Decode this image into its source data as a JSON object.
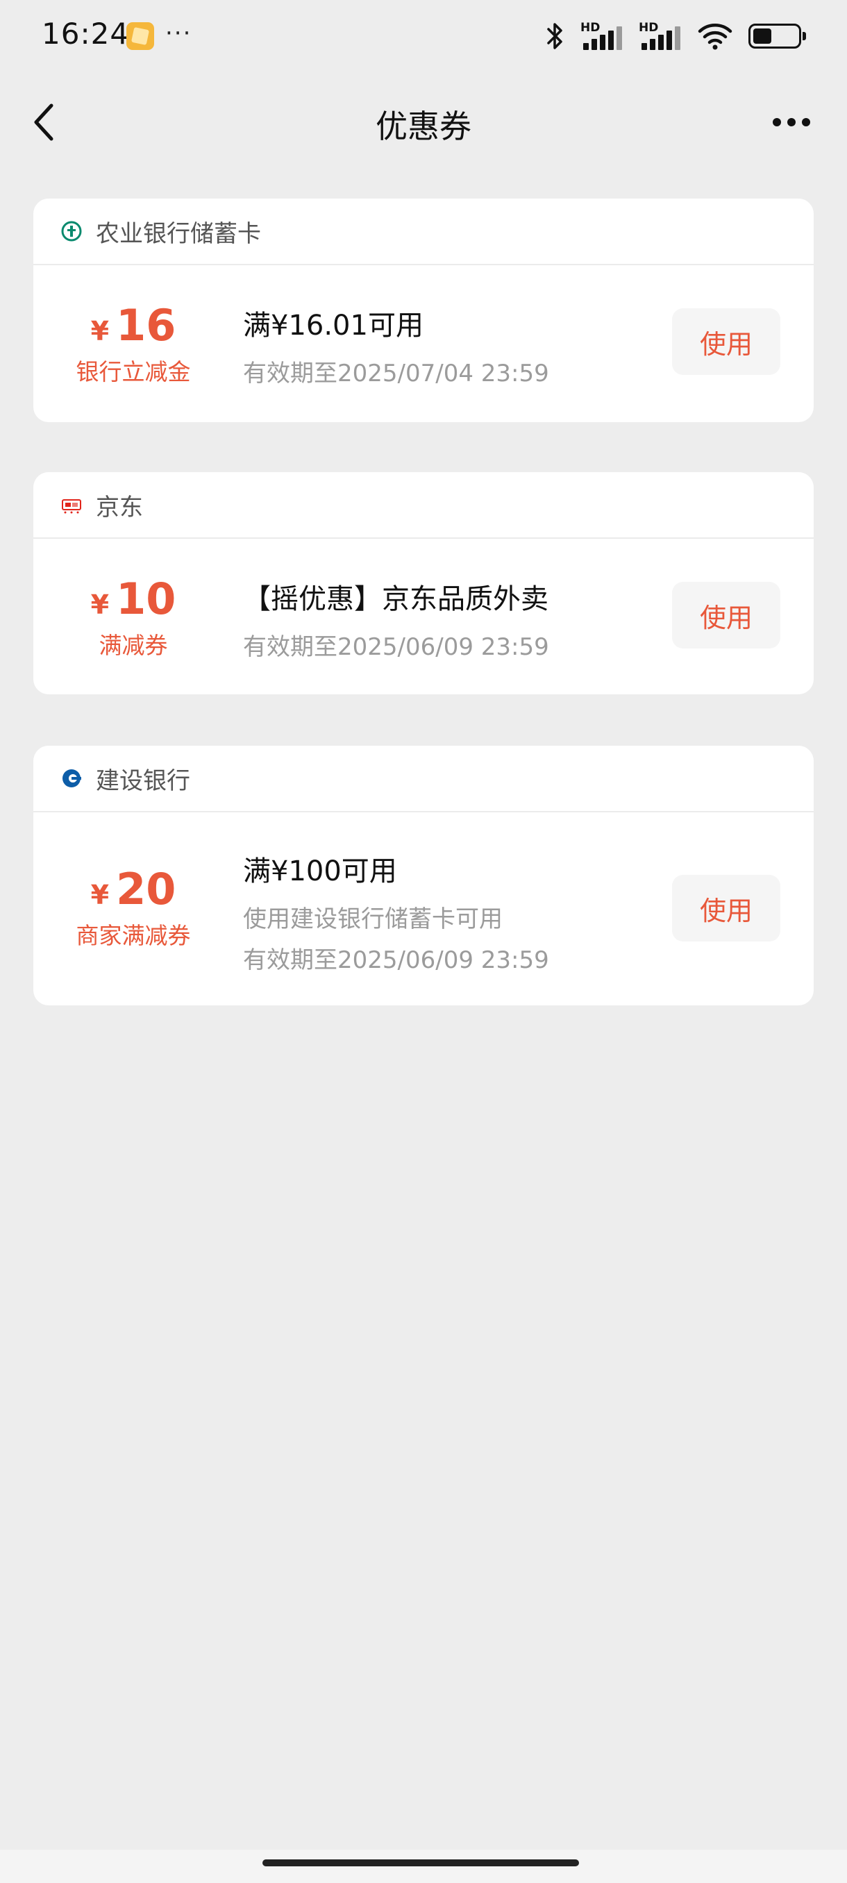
{
  "status_bar": {
    "time": "16:24",
    "more": "···",
    "signal1_label": "HD",
    "signal2_label": "HD",
    "battery_level": 0.42,
    "icons": [
      "notification-app-icon",
      "bluetooth-icon",
      "signal-icon",
      "signal-icon",
      "wifi-icon",
      "battery-icon"
    ]
  },
  "nav": {
    "title": "优惠券",
    "back_icon": "chevron-left-icon",
    "more_icon": "more-dots-icon"
  },
  "accent_color": "#e8583a",
  "coupons": [
    {
      "merchant": "农业银行储蓄卡",
      "logo": "abc-bank-logo",
      "currency": "¥",
      "amount": "16",
      "amount_type": "银行立减金",
      "title": "满¥16.01可用",
      "sub": "有效期至2025/07/04 23:59",
      "button": "使用"
    },
    {
      "merchant": "京东",
      "logo": "jd-logo",
      "currency": "¥",
      "amount": "10",
      "amount_type": "满减券",
      "title": "【摇优惠】京东品质外卖",
      "sub": "有效期至2025/06/09 23:59",
      "button": "使用"
    },
    {
      "merchant": "建设银行",
      "logo": "ccb-bank-logo",
      "currency": "¥",
      "amount": "20",
      "amount_type": "商家满减券",
      "title": "满¥100可用",
      "sub": "使用建设银行储蓄卡可用",
      "sub2": "有效期至2025/06/09 23:59",
      "button": "使用"
    }
  ]
}
